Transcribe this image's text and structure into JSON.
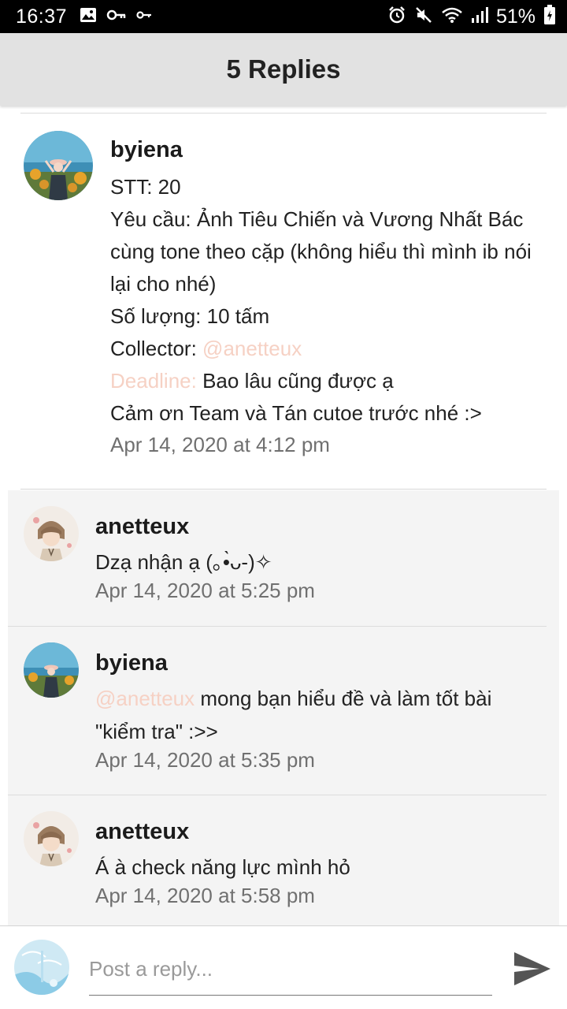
{
  "status_bar": {
    "time": "16:37",
    "battery": "51%"
  },
  "header": {
    "title": "5 Replies"
  },
  "main_comment": {
    "username": "byiena",
    "lines": {
      "stt": "STT: 20",
      "request_1": "Yêu cầu: Ảnh Tiêu Chiến và Vương Nhất Bác",
      "request_2": "cùng tone theo cặp (không hiểu thì mình ib nói",
      "request_3": "lại cho nhé)",
      "quantity": "Số lượng: 10 tấm",
      "collector_label": "Collector: ",
      "collector_mention": "@anetteux",
      "deadline_label": "Deadline:",
      "deadline_value": " Bao lâu cũng được ạ",
      "thanks": "Cảm ơn Team và Tán cutoe trước nhé :>"
    },
    "timestamp": "Apr 14, 2020 at 4:12 pm"
  },
  "replies": [
    {
      "username": "anetteux",
      "text": "Dzạ nhận ạ (｡•̀ᴗ-)✧",
      "timestamp": "Apr 14, 2020 at 5:25 pm"
    },
    {
      "username": "byiena",
      "mention": "@anetteux",
      "text_1": " mong bạn hiểu đề và làm tốt bài",
      "text_2": "\"kiểm tra\" :>>",
      "timestamp": "Apr 14, 2020 at 5:35 pm"
    },
    {
      "username": "anetteux",
      "text": "Á à check năng lực mình hỏ",
      "timestamp": "Apr 14, 2020 at 5:58 pm"
    }
  ],
  "reply_bar": {
    "placeholder": "Post a reply..."
  },
  "colors": {
    "mention": "#f6d1c4",
    "header_bg": "#e2e2e2",
    "reply_bg": "#f4f4f4",
    "timestamp": "#707070",
    "send_icon": "#555555"
  },
  "icons": {
    "status_left": [
      "image-icon",
      "key-icon",
      "vpn-key-icon"
    ],
    "status_right": [
      "alarm-icon",
      "mute-icon",
      "wifi-icon",
      "signal-icon",
      "battery-charging-icon"
    ],
    "send": "send-icon"
  }
}
